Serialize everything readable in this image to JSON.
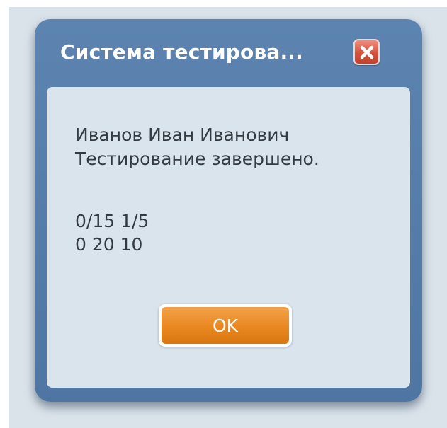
{
  "dialog": {
    "title": "Система тестирова...",
    "close_icon": "close-icon",
    "message_lines": [
      "Иванов Иван Иванович",
      "Тестирование завершено.",
      "0/15 1/5",
      "0 20 10"
    ],
    "ok_label": "OK"
  },
  "colors": {
    "frame": "#5a80ad",
    "content_bg": "#dae4ed",
    "close_button": "#d3533c",
    "ok_button": "#e98720",
    "text": "#333a40"
  }
}
